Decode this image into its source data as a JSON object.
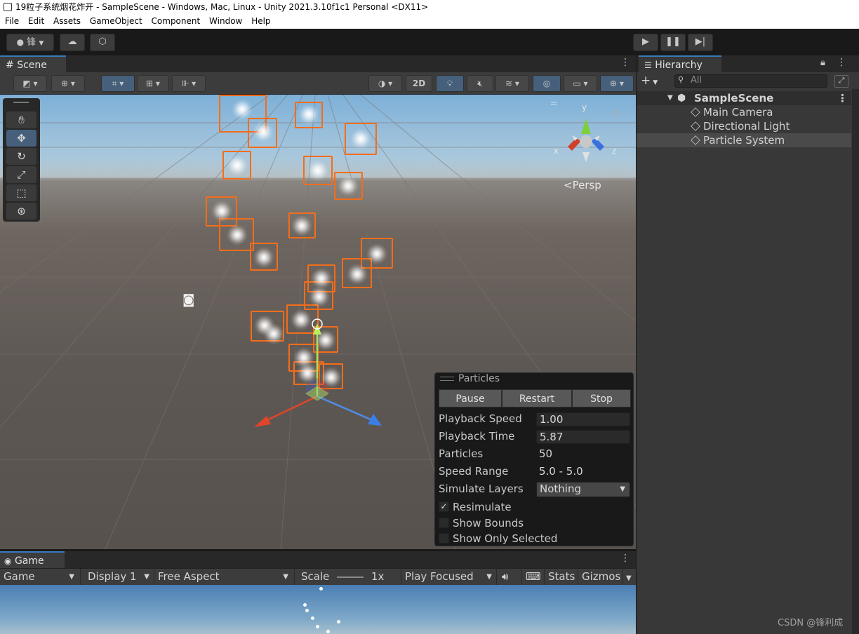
{
  "window": {
    "title": "19粒子系统烟花炸开 - SampleScene - Windows, Mac, Linux - Unity 2021.3.10f1c1 Personal <DX11>"
  },
  "menu": [
    "File",
    "Edit",
    "Assets",
    "GameObject",
    "Component",
    "Window",
    "Help"
  ],
  "toolbar": {
    "account_label": "锋"
  },
  "scene": {
    "tab_label": "Scene",
    "btn_2d": "2D",
    "persp_label": "<Persp",
    "gizmo_axes": {
      "x": "x",
      "y": "y",
      "z": "z"
    }
  },
  "particles_panel": {
    "title": "Particles",
    "pause": "Pause",
    "restart": "Restart",
    "stop": "Stop",
    "playback_speed_label": "Playback Speed",
    "playback_speed": "1.00",
    "playback_time_label": "Playback Time",
    "playback_time": "5.87",
    "particles_label": "Particles",
    "particles": "50",
    "speed_range_label": "Speed Range",
    "speed_range": "5.0 - 5.0",
    "simulate_layers_label": "Simulate Layers",
    "simulate_layers": "Nothing",
    "resimulate": "Resimulate",
    "show_bounds": "Show Bounds",
    "show_only_selected": "Show Only Selected",
    "check_mark": "✓"
  },
  "game": {
    "tab_label": "Game",
    "display_mode": "Game",
    "display": "Display 1",
    "aspect": "Free Aspect",
    "scale_label": "Scale",
    "scale_value": "1x",
    "play_mode": "Play Focused",
    "stats": "Stats",
    "gizmos": "Gizmos"
  },
  "hierarchy": {
    "tab_label": "Hierarchy",
    "search_placeholder": "All",
    "scene_name": "SampleScene",
    "items": [
      "Main Camera",
      "Directional Light",
      "Particle System"
    ]
  },
  "watermark": "CSDN @锋利成",
  "colors": {
    "selection_outline": "#f46d1a",
    "active_button": "#46607c"
  }
}
